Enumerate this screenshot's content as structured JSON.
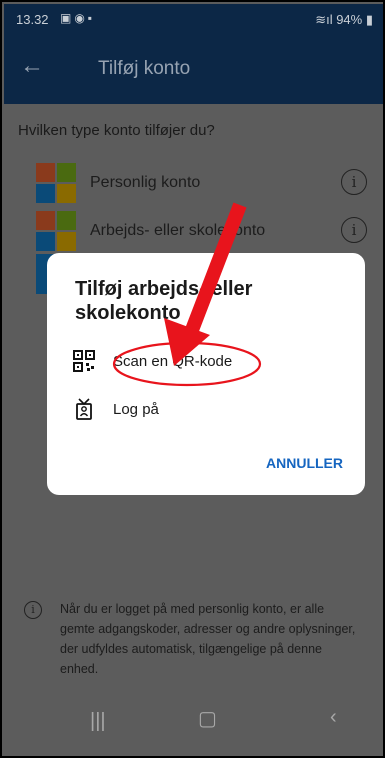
{
  "status_bar": {
    "time": "13.32",
    "right": "94%"
  },
  "app_bar": {
    "title": "Tilføj konto",
    "back_icon": "arrow-left-icon"
  },
  "question": "Hvilken type konto tilføjer du?",
  "account_types": [
    {
      "label": "Personlig konto",
      "icon": "microsoft-logo-icon"
    },
    {
      "label": "Arbejds- eller skolekonto",
      "icon": "microsoft-logo-icon"
    }
  ],
  "dialog": {
    "title": "Tilføj arbejds- eller skolekonto",
    "options": [
      {
        "label": "Scan en QR-kode",
        "icon": "qr-code-icon"
      },
      {
        "label": "Log på",
        "icon": "badge-icon"
      }
    ],
    "cancel_label": "ANNULLER"
  },
  "footer_text": "Når du er logget på med personlig konto, er alle gemte adgangskoder, adresser og andre oplysninger, der udfyldes automatisk, tilgængelige på denne enhed.",
  "colors": {
    "app_bar": "#0c2746",
    "dim_background": "#5c5c5c",
    "accent": "#1565c0",
    "annotation_red": "#e8141c",
    "ms_red": "#8a3a1c",
    "ms_green": "#4a6a10",
    "ms_blue": "#0a4a78",
    "ms_yellow": "#8a6a00"
  }
}
